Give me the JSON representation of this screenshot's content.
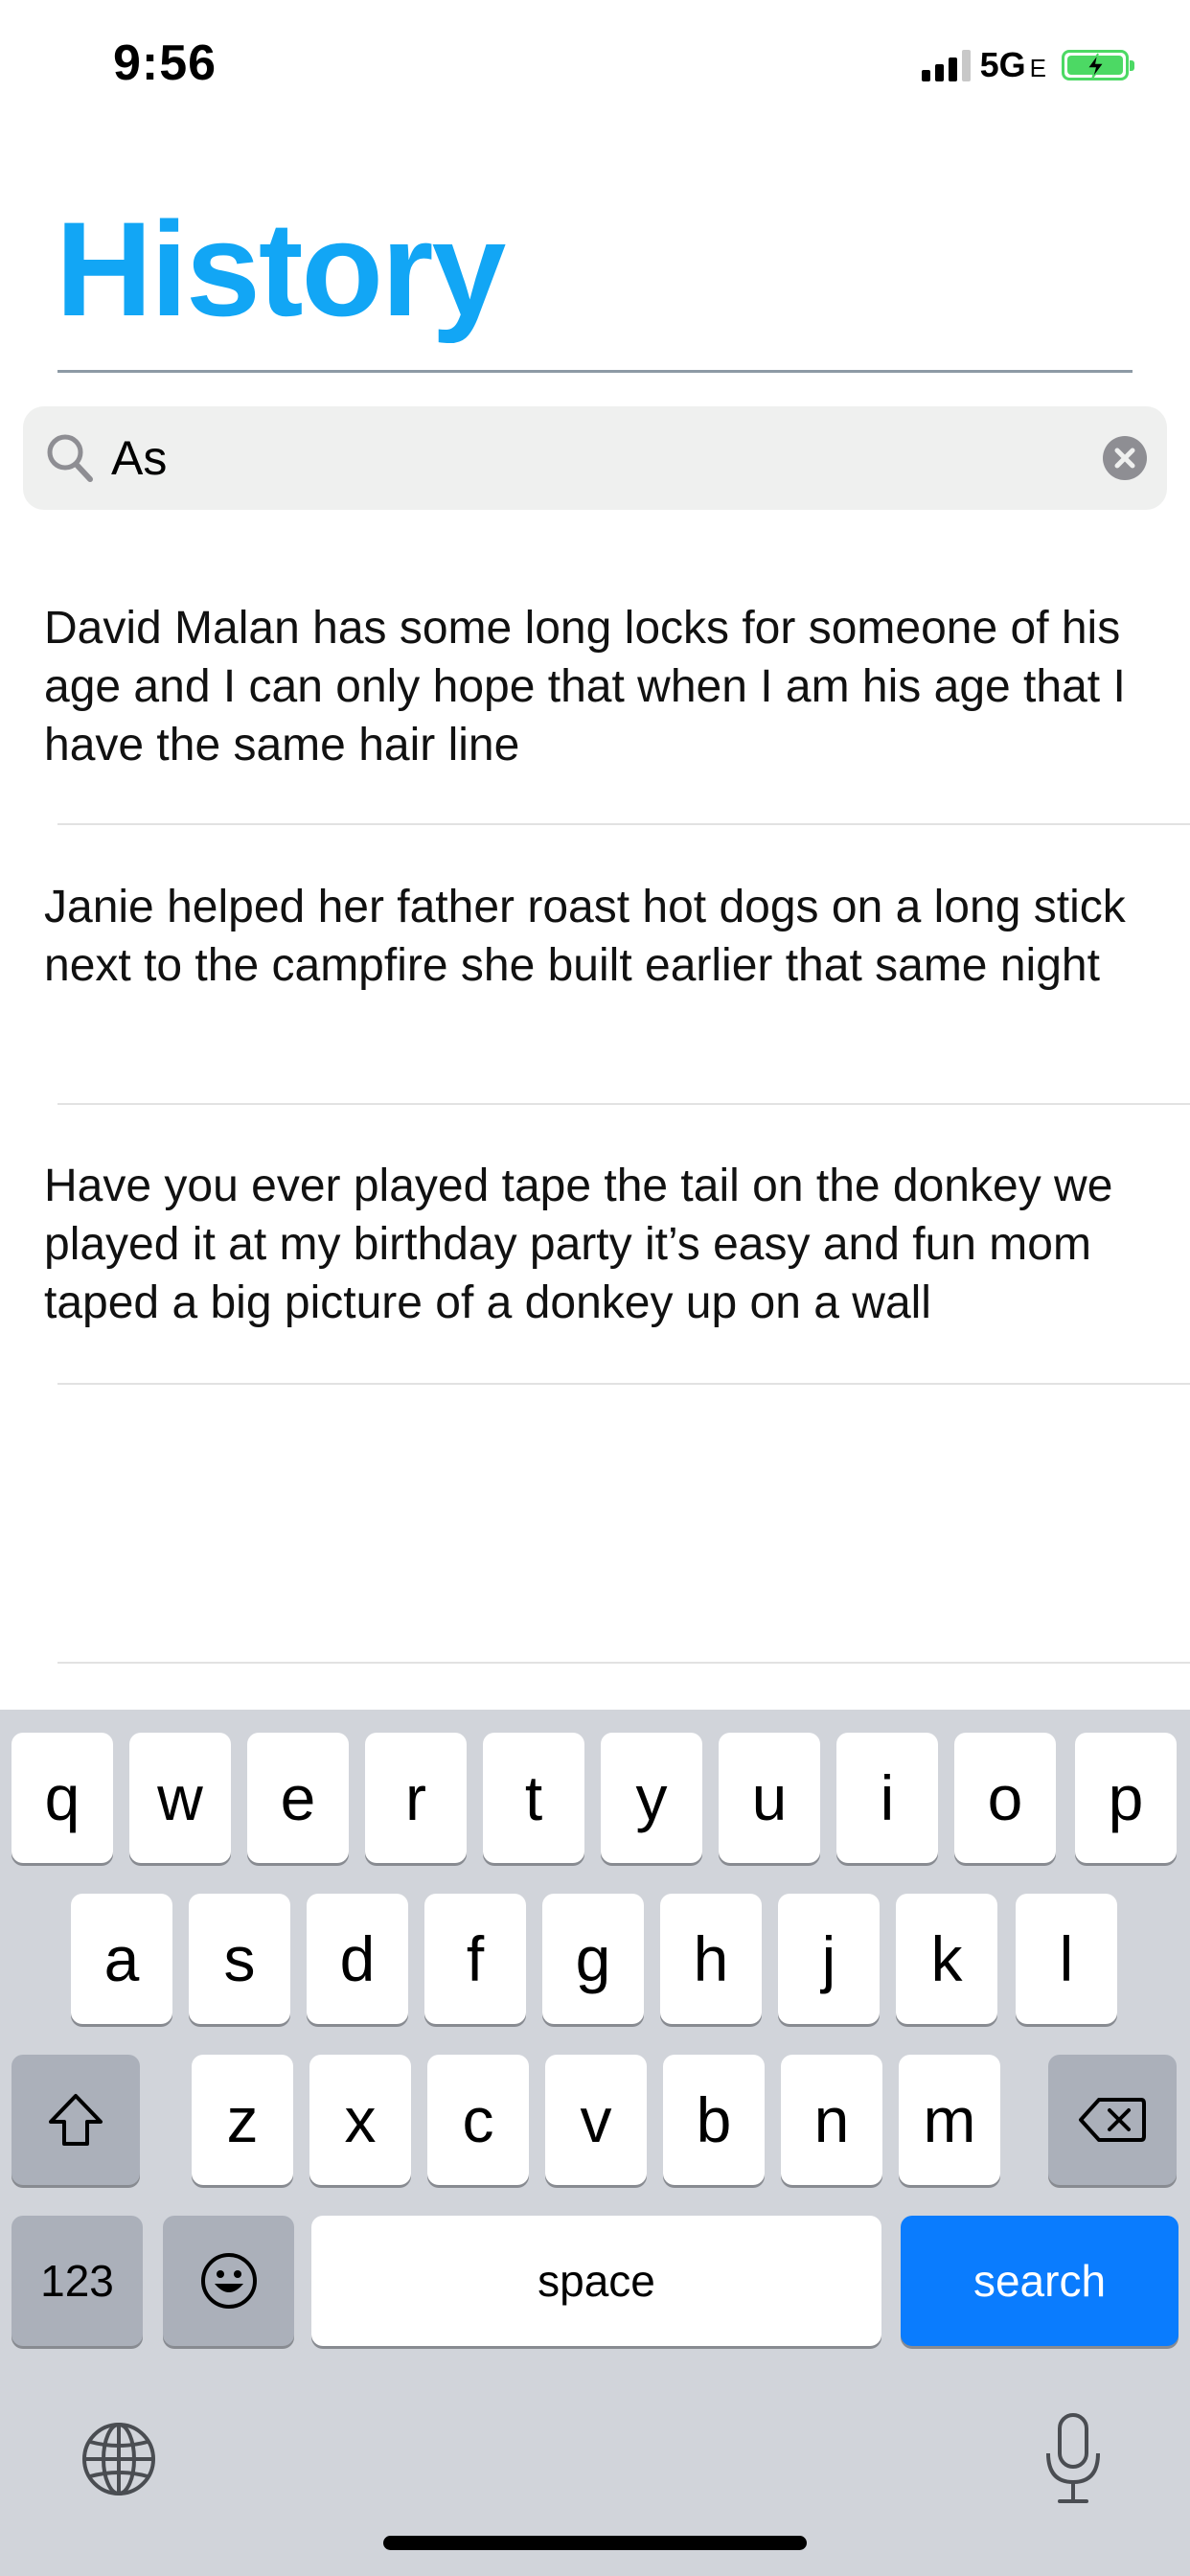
{
  "status_bar": {
    "time": "9:56",
    "network": "5G",
    "network_suffix": "E",
    "battery_color": "#4cd964"
  },
  "header": {
    "title": "History",
    "title_color": "#12a6f5"
  },
  "search": {
    "value": "As",
    "icon": "search-icon",
    "clear_icon": "clear-circle-icon"
  },
  "results": [
    {
      "text": "David Malan has some long locks for someone of his age and I can only hope that when I am his age that I have the same hair line"
    },
    {
      "text": "Janie helped her father roast hot dogs on a long stick next to the campfire she built earlier that same night"
    },
    {
      "text": "Have you ever played tape the tail on the donkey we played it at my birthday party it’s easy and fun mom taped a big picture of a donkey up on a wall"
    }
  ],
  "keyboard": {
    "row1": [
      "q",
      "w",
      "e",
      "r",
      "t",
      "y",
      "u",
      "i",
      "o",
      "p"
    ],
    "row2": [
      "a",
      "s",
      "d",
      "f",
      "g",
      "h",
      "j",
      "k",
      "l"
    ],
    "row3": [
      "z",
      "x",
      "c",
      "v",
      "b",
      "n",
      "m"
    ],
    "numbers_label": "123",
    "space_label": "space",
    "search_label": "search",
    "search_color": "#0a7cfe"
  }
}
